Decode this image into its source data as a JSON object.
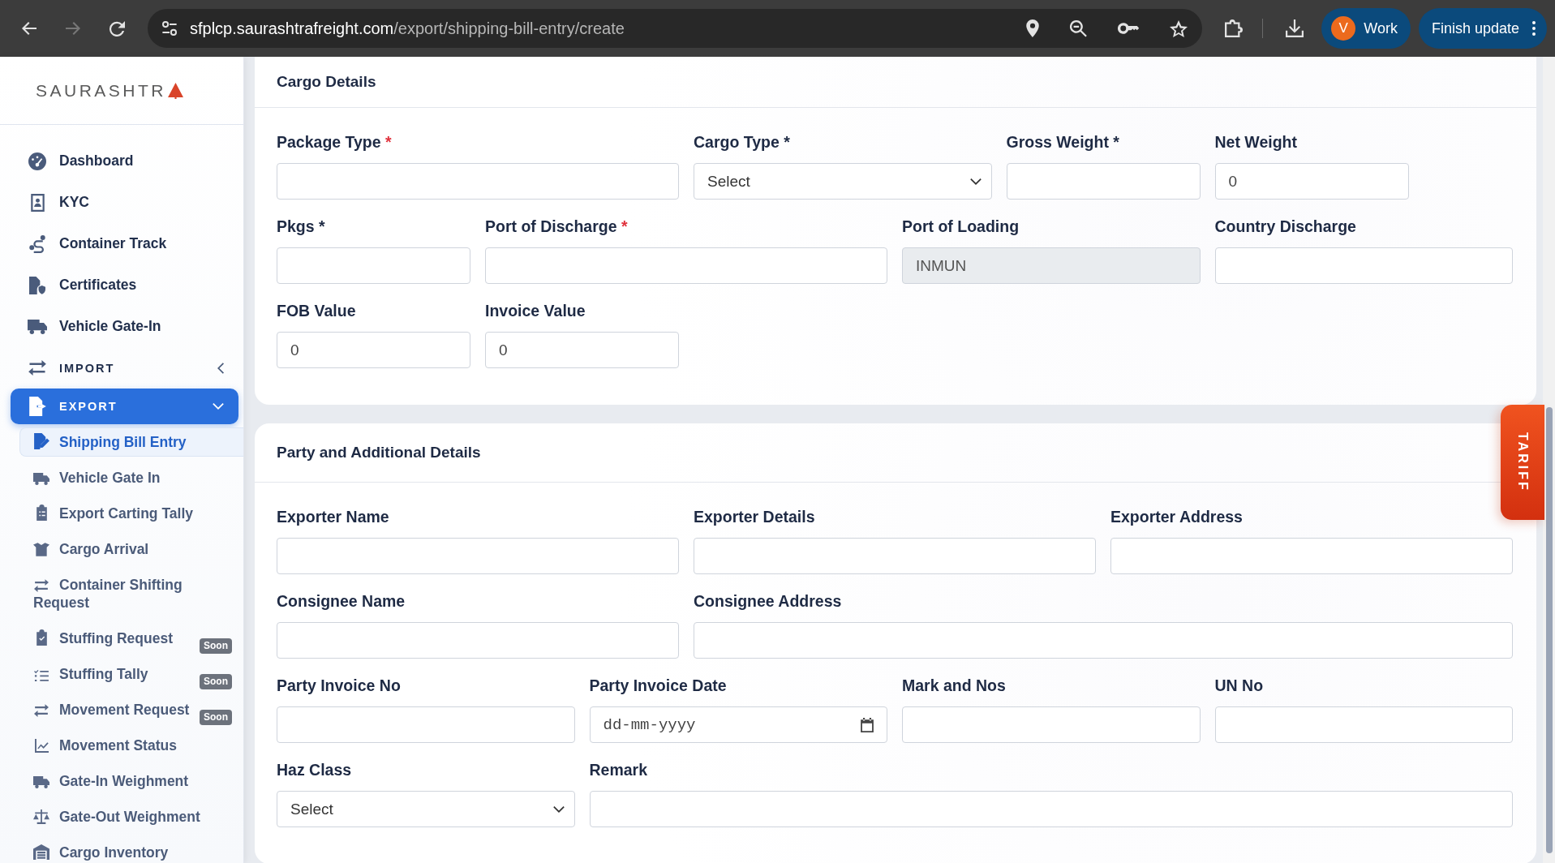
{
  "browser": {
    "back_disabled": false,
    "forward_disabled": true,
    "url": {
      "host": "sfplcp.saurashtrafreight.com",
      "path": "/export/shipping-bill-entry/create"
    },
    "profile": {
      "initial": "V",
      "label": "Work"
    },
    "update_button": "Finish update"
  },
  "sidebar": {
    "logo": "SAURASHTR",
    "items": [
      {
        "kind": "link",
        "label": "Dashboard"
      },
      {
        "kind": "link",
        "label": "KYC"
      },
      {
        "kind": "link",
        "label": "Container Track"
      },
      {
        "kind": "link",
        "label": "Certificates"
      },
      {
        "kind": "link",
        "label": "Vehicle Gate-In"
      },
      {
        "kind": "section",
        "label": "IMPORT",
        "selected": false,
        "expanded": false
      },
      {
        "kind": "section",
        "label": "EXPORT",
        "selected": true,
        "expanded": true,
        "children": [
          {
            "label": "Shipping Bill Entry",
            "selected": true
          },
          {
            "label": "Vehicle Gate In",
            "selected": false
          },
          {
            "label": "Export Carting Tally",
            "selected": false
          },
          {
            "label": "Cargo Arrival",
            "selected": false
          },
          {
            "label": "Container Shifting Request",
            "selected": false
          },
          {
            "label": "Stuffing Request",
            "selected": false,
            "badge": "Soon"
          },
          {
            "label": "Stuffing Tally",
            "selected": false,
            "badge": "Soon"
          },
          {
            "label": "Movement Request",
            "selected": false,
            "badge": "Soon"
          },
          {
            "label": "Movement Status",
            "selected": false
          },
          {
            "label": "Gate-In Weighment",
            "selected": false
          },
          {
            "label": "Gate-Out Weighment",
            "selected": false
          },
          {
            "label": "Cargo Inventory",
            "selected": false
          }
        ]
      }
    ]
  },
  "sections": [
    {
      "title": "Cargo Details",
      "rows": [
        [
          {
            "label": "Package Type",
            "required_mark": "*",
            "kind": "text"
          },
          {
            "label": "Cargo Type *",
            "kind": "select",
            "value": "Select"
          },
          {
            "label": "Gross Weight *",
            "kind": "text"
          },
          {
            "label": "Net Weight",
            "kind": "text",
            "value": "0"
          }
        ],
        [
          {
            "label": "Pkgs *",
            "kind": "text"
          },
          {
            "label": "Port of Discharge",
            "required_mark": "*",
            "kind": "text"
          },
          {
            "label": "Port of Loading",
            "kind": "readonly",
            "value": "INMUN"
          },
          {
            "label": "Country Discharge",
            "kind": "text"
          }
        ],
        [
          {
            "label": "FOB Value",
            "kind": "text",
            "value": "0"
          },
          {
            "label": "Invoice Value",
            "kind": "text",
            "value": "0"
          }
        ]
      ]
    },
    {
      "title": "Party and Additional Details",
      "rows": [
        [
          {
            "label": "Exporter Name",
            "kind": "text"
          },
          {
            "label": "Exporter Details",
            "kind": "text"
          },
          {
            "label": "Exporter Address",
            "kind": "text"
          }
        ],
        [
          {
            "label": "Consignee Name",
            "kind": "text"
          },
          {
            "label": "Consignee Address",
            "kind": "text"
          }
        ],
        [
          {
            "label": "Party Invoice No",
            "kind": "text"
          },
          {
            "label": "Party Invoice Date",
            "kind": "date",
            "placeholder": "dd-mm-yyyy"
          },
          {
            "label": "Mark and Nos",
            "kind": "text"
          },
          {
            "label": "UN No",
            "kind": "text"
          }
        ],
        [
          {
            "label": "Haz Class",
            "kind": "select",
            "value": "Select"
          },
          {
            "label": "Remark",
            "kind": "text"
          }
        ]
      ]
    }
  ],
  "tariff_tab": "TARIFF"
}
